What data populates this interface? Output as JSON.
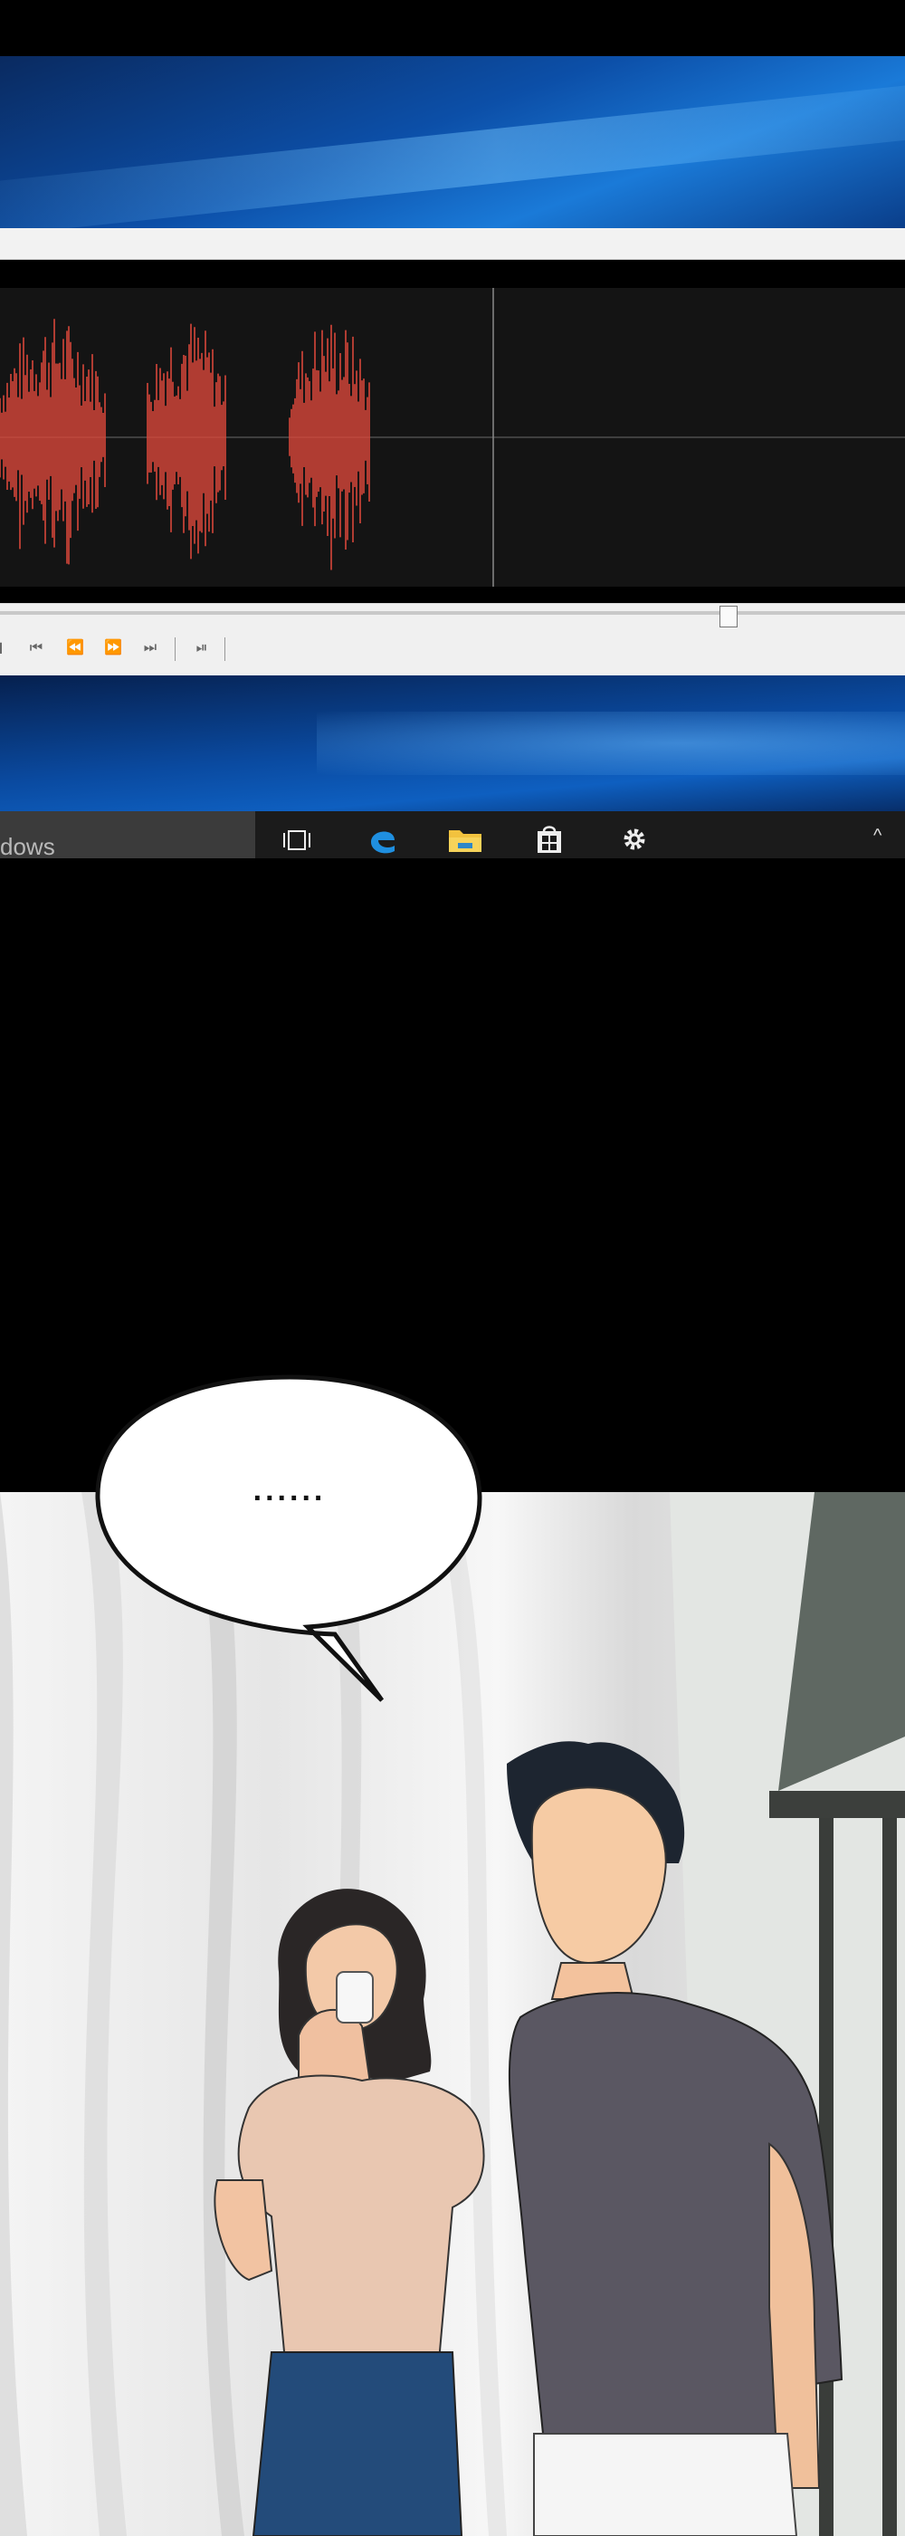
{
  "taskbar": {
    "search_text": "dows",
    "icons": [
      "task-view-icon",
      "edge-icon",
      "file-explorer-icon",
      "store-icon",
      "settings-icon"
    ],
    "tray_chevron": "^"
  },
  "player": {
    "controls": [
      "skip-start-icon",
      "rewind-icon",
      "forward-icon",
      "skip-end-icon",
      "step-icon"
    ],
    "seek_position": 0.805
  },
  "waveform": {
    "color": "#d8473a",
    "background": "#141414"
  },
  "comic": {
    "speech_bubble": "......"
  }
}
